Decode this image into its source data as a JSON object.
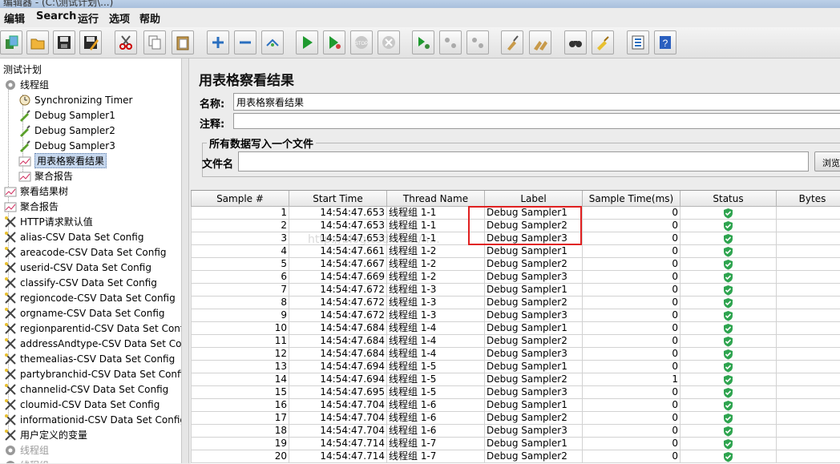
{
  "window": {
    "title_fragment": "编辑器 - (C:\\测试计划\\...)"
  },
  "menu": [
    "编辑",
    "Search",
    "运行",
    "选项",
    "帮助"
  ],
  "toolbar": {
    "buttons": [
      "new-icon",
      "open-icon",
      "save-icon",
      "save-as-icon",
      "cut-icon",
      "copy-icon",
      "paste-icon",
      "expand-icon",
      "collapse-icon",
      "toggle-icon",
      "start-icon",
      "start-no-pause-icon",
      "stop-icon",
      "shutdown-icon",
      "remote-start-icon",
      "remote-stop-icon",
      "remote-shutdown-icon",
      "clear-icon",
      "clear-all-icon",
      "search-icon",
      "reset-search-icon",
      "function-helper-icon",
      "help-icon"
    ]
  },
  "tree": {
    "root": "测试计划",
    "items": [
      {
        "label": "线程组",
        "icon": "thread-group-icon",
        "level": 0
      },
      {
        "label": "Synchronizing Timer",
        "icon": "timer-icon",
        "level": 1
      },
      {
        "label": "Debug Sampler1",
        "icon": "sampler-icon",
        "level": 1
      },
      {
        "label": "Debug Sampler2",
        "icon": "sampler-icon",
        "level": 1
      },
      {
        "label": "Debug Sampler3",
        "icon": "sampler-icon",
        "level": 1
      },
      {
        "label": "用表格察看结果",
        "icon": "listener-icon",
        "level": 1,
        "selected": true
      },
      {
        "label": "聚合报告",
        "icon": "listener-icon",
        "level": 1
      },
      {
        "label": "察看结果树",
        "icon": "listener-icon",
        "level": 0
      },
      {
        "label": "聚合报告",
        "icon": "listener-icon",
        "level": 0
      },
      {
        "label": "HTTP请求默认值",
        "icon": "config-icon",
        "level": 0
      },
      {
        "label": "alias-CSV Data Set Config",
        "icon": "config-icon",
        "level": 0
      },
      {
        "label": "areacode-CSV Data Set Config",
        "icon": "config-icon",
        "level": 0
      },
      {
        "label": "userid-CSV Data Set Config",
        "icon": "config-icon",
        "level": 0
      },
      {
        "label": "classify-CSV Data Set Config",
        "icon": "config-icon",
        "level": 0
      },
      {
        "label": "regioncode-CSV Data Set Config",
        "icon": "config-icon",
        "level": 0
      },
      {
        "label": "orgname-CSV Data Set Config",
        "icon": "config-icon",
        "level": 0
      },
      {
        "label": "regionparentid-CSV Data Set Config",
        "icon": "config-icon",
        "level": 0
      },
      {
        "label": "addressAndtype-CSV Data Set Confi",
        "icon": "config-icon",
        "level": 0
      },
      {
        "label": "themealias-CSV Data Set Config",
        "icon": "config-icon",
        "level": 0
      },
      {
        "label": "partybranchid-CSV Data Set Config",
        "icon": "config-icon",
        "level": 0
      },
      {
        "label": "channelid-CSV Data Set Config",
        "icon": "config-icon",
        "level": 0
      },
      {
        "label": "cloumid-CSV Data Set Config",
        "icon": "config-icon",
        "level": 0
      },
      {
        "label": "informationid-CSV Data Set Config",
        "icon": "config-icon",
        "level": 0
      },
      {
        "label": "用户定义的变量",
        "icon": "config-icon",
        "level": 0
      },
      {
        "label": "线程组",
        "icon": "thread-group-icon",
        "level": 0,
        "disabled": true
      },
      {
        "label": "线程组",
        "icon": "thread-group-icon",
        "level": 0,
        "disabled": true
      }
    ]
  },
  "panel": {
    "title": "用表格察看结果",
    "name_label": "名称:",
    "name_value": "用表格察看结果",
    "comment_label": "注释:",
    "comment_value": "",
    "file_group_title": "所有数据写入一个文件",
    "filename_label": "文件名",
    "filename_value": "",
    "browse_label": "浏览..."
  },
  "table": {
    "columns": [
      "Sample #",
      "Start Time",
      "Thread Name",
      "Label",
      "Sample Time(ms)",
      "Status",
      "Bytes"
    ],
    "rows": [
      [
        "1",
        "14:54:47.653",
        "线程组 1-1",
        "Debug Sampler1",
        "0",
        "ok",
        ""
      ],
      [
        "2",
        "14:54:47.653",
        "线程组 1-1",
        "Debug Sampler2",
        "0",
        "ok",
        ""
      ],
      [
        "3",
        "14:54:47.653",
        "线程组 1-1",
        "Debug Sampler3",
        "0",
        "ok",
        ""
      ],
      [
        "4",
        "14:54:47.661",
        "线程组 1-2",
        "Debug Sampler1",
        "0",
        "ok",
        ""
      ],
      [
        "5",
        "14:54:47.667",
        "线程组 1-2",
        "Debug Sampler2",
        "0",
        "ok",
        ""
      ],
      [
        "6",
        "14:54:47.669",
        "线程组 1-2",
        "Debug Sampler3",
        "0",
        "ok",
        ""
      ],
      [
        "7",
        "14:54:47.672",
        "线程组 1-3",
        "Debug Sampler1",
        "0",
        "ok",
        ""
      ],
      [
        "8",
        "14:54:47.672",
        "线程组 1-3",
        "Debug Sampler2",
        "0",
        "ok",
        ""
      ],
      [
        "9",
        "14:54:47.672",
        "线程组 1-3",
        "Debug Sampler3",
        "0",
        "ok",
        ""
      ],
      [
        "10",
        "14:54:47.684",
        "线程组 1-4",
        "Debug Sampler1",
        "0",
        "ok",
        ""
      ],
      [
        "11",
        "14:54:47.684",
        "线程组 1-4",
        "Debug Sampler2",
        "0",
        "ok",
        ""
      ],
      [
        "12",
        "14:54:47.684",
        "线程组 1-4",
        "Debug Sampler3",
        "0",
        "ok",
        ""
      ],
      [
        "13",
        "14:54:47.694",
        "线程组 1-5",
        "Debug Sampler1",
        "0",
        "ok",
        ""
      ],
      [
        "14",
        "14:54:47.694",
        "线程组 1-5",
        "Debug Sampler2",
        "1",
        "ok",
        ""
      ],
      [
        "15",
        "14:54:47.695",
        "线程组 1-5",
        "Debug Sampler3",
        "0",
        "ok",
        ""
      ],
      [
        "16",
        "14:54:47.704",
        "线程组 1-6",
        "Debug Sampler1",
        "0",
        "ok",
        ""
      ],
      [
        "17",
        "14:54:47.704",
        "线程组 1-6",
        "Debug Sampler2",
        "0",
        "ok",
        ""
      ],
      [
        "18",
        "14:54:47.704",
        "线程组 1-6",
        "Debug Sampler3",
        "0",
        "ok",
        ""
      ],
      [
        "19",
        "14:54:47.714",
        "线程组 1-7",
        "Debug Sampler1",
        "0",
        "ok",
        ""
      ],
      [
        "20",
        "14:54:47.714",
        "线程组 1-7",
        "Debug Sampler2",
        "0",
        "ok",
        ""
      ]
    ]
  },
  "watermark": "http://blog.csdn.net/h...",
  "colors": {
    "status_ok": "#2ea44f",
    "highlight": "#e02020",
    "selection": "#c7d8ee"
  }
}
